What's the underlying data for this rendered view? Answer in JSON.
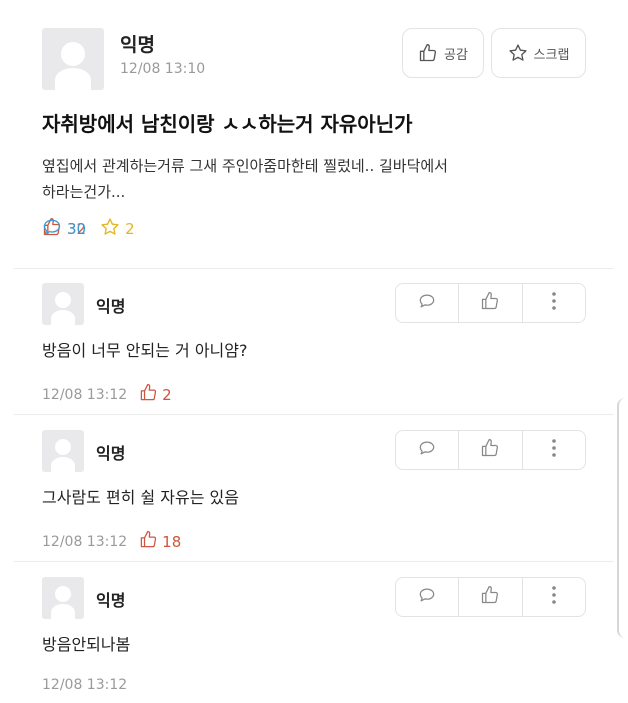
{
  "post": {
    "author": "익명",
    "time": "12/08 13:10",
    "like_button_label": "공감",
    "scrap_button_label": "스크랩",
    "title": "자취방에서 남친이랑 ㅅㅅ하는거 자유아닌가",
    "body_line1": "옆집에서 관계하는거류 그새 주인아줌마한테 찔렀네.. 길바닥에서",
    "body_line2": "하라는건가...",
    "likes": "32",
    "comments": "30",
    "scraps": "2"
  },
  "comments": [
    {
      "author": "익명",
      "text": "방음이 너무 안되는 거 아니얌?",
      "time": "12/08 13:12",
      "likes": "2"
    },
    {
      "author": "익명",
      "text": "그사람도 편히 쉴 자유는 있음",
      "time": "12/08 13:12",
      "likes": "18"
    },
    {
      "author": "익명",
      "text": "방음안되나봄",
      "time": "12/08 13:12",
      "likes": ""
    }
  ],
  "colors": {
    "like": "#d0553e",
    "comment": "#3a9bd6",
    "scrap": "#e3b622",
    "muted": "#9a9a9a"
  },
  "icons": [
    "thumbs-up-icon",
    "star-icon",
    "speech-bubble-icon",
    "more-vertical-icon",
    "avatar-icon"
  ]
}
